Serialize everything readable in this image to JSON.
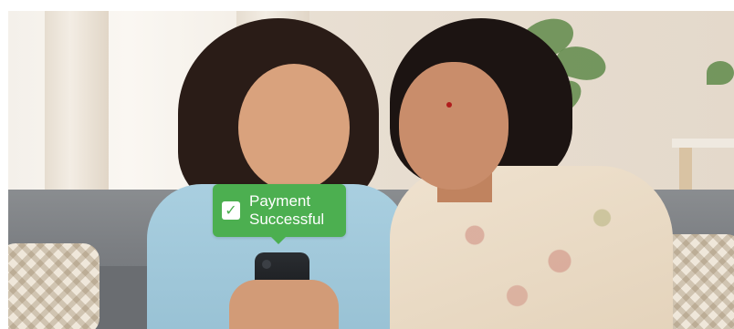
{
  "overlay": {
    "icon": "check-icon",
    "line1": "Payment",
    "line2": "Successful",
    "color": "#4caf50"
  }
}
